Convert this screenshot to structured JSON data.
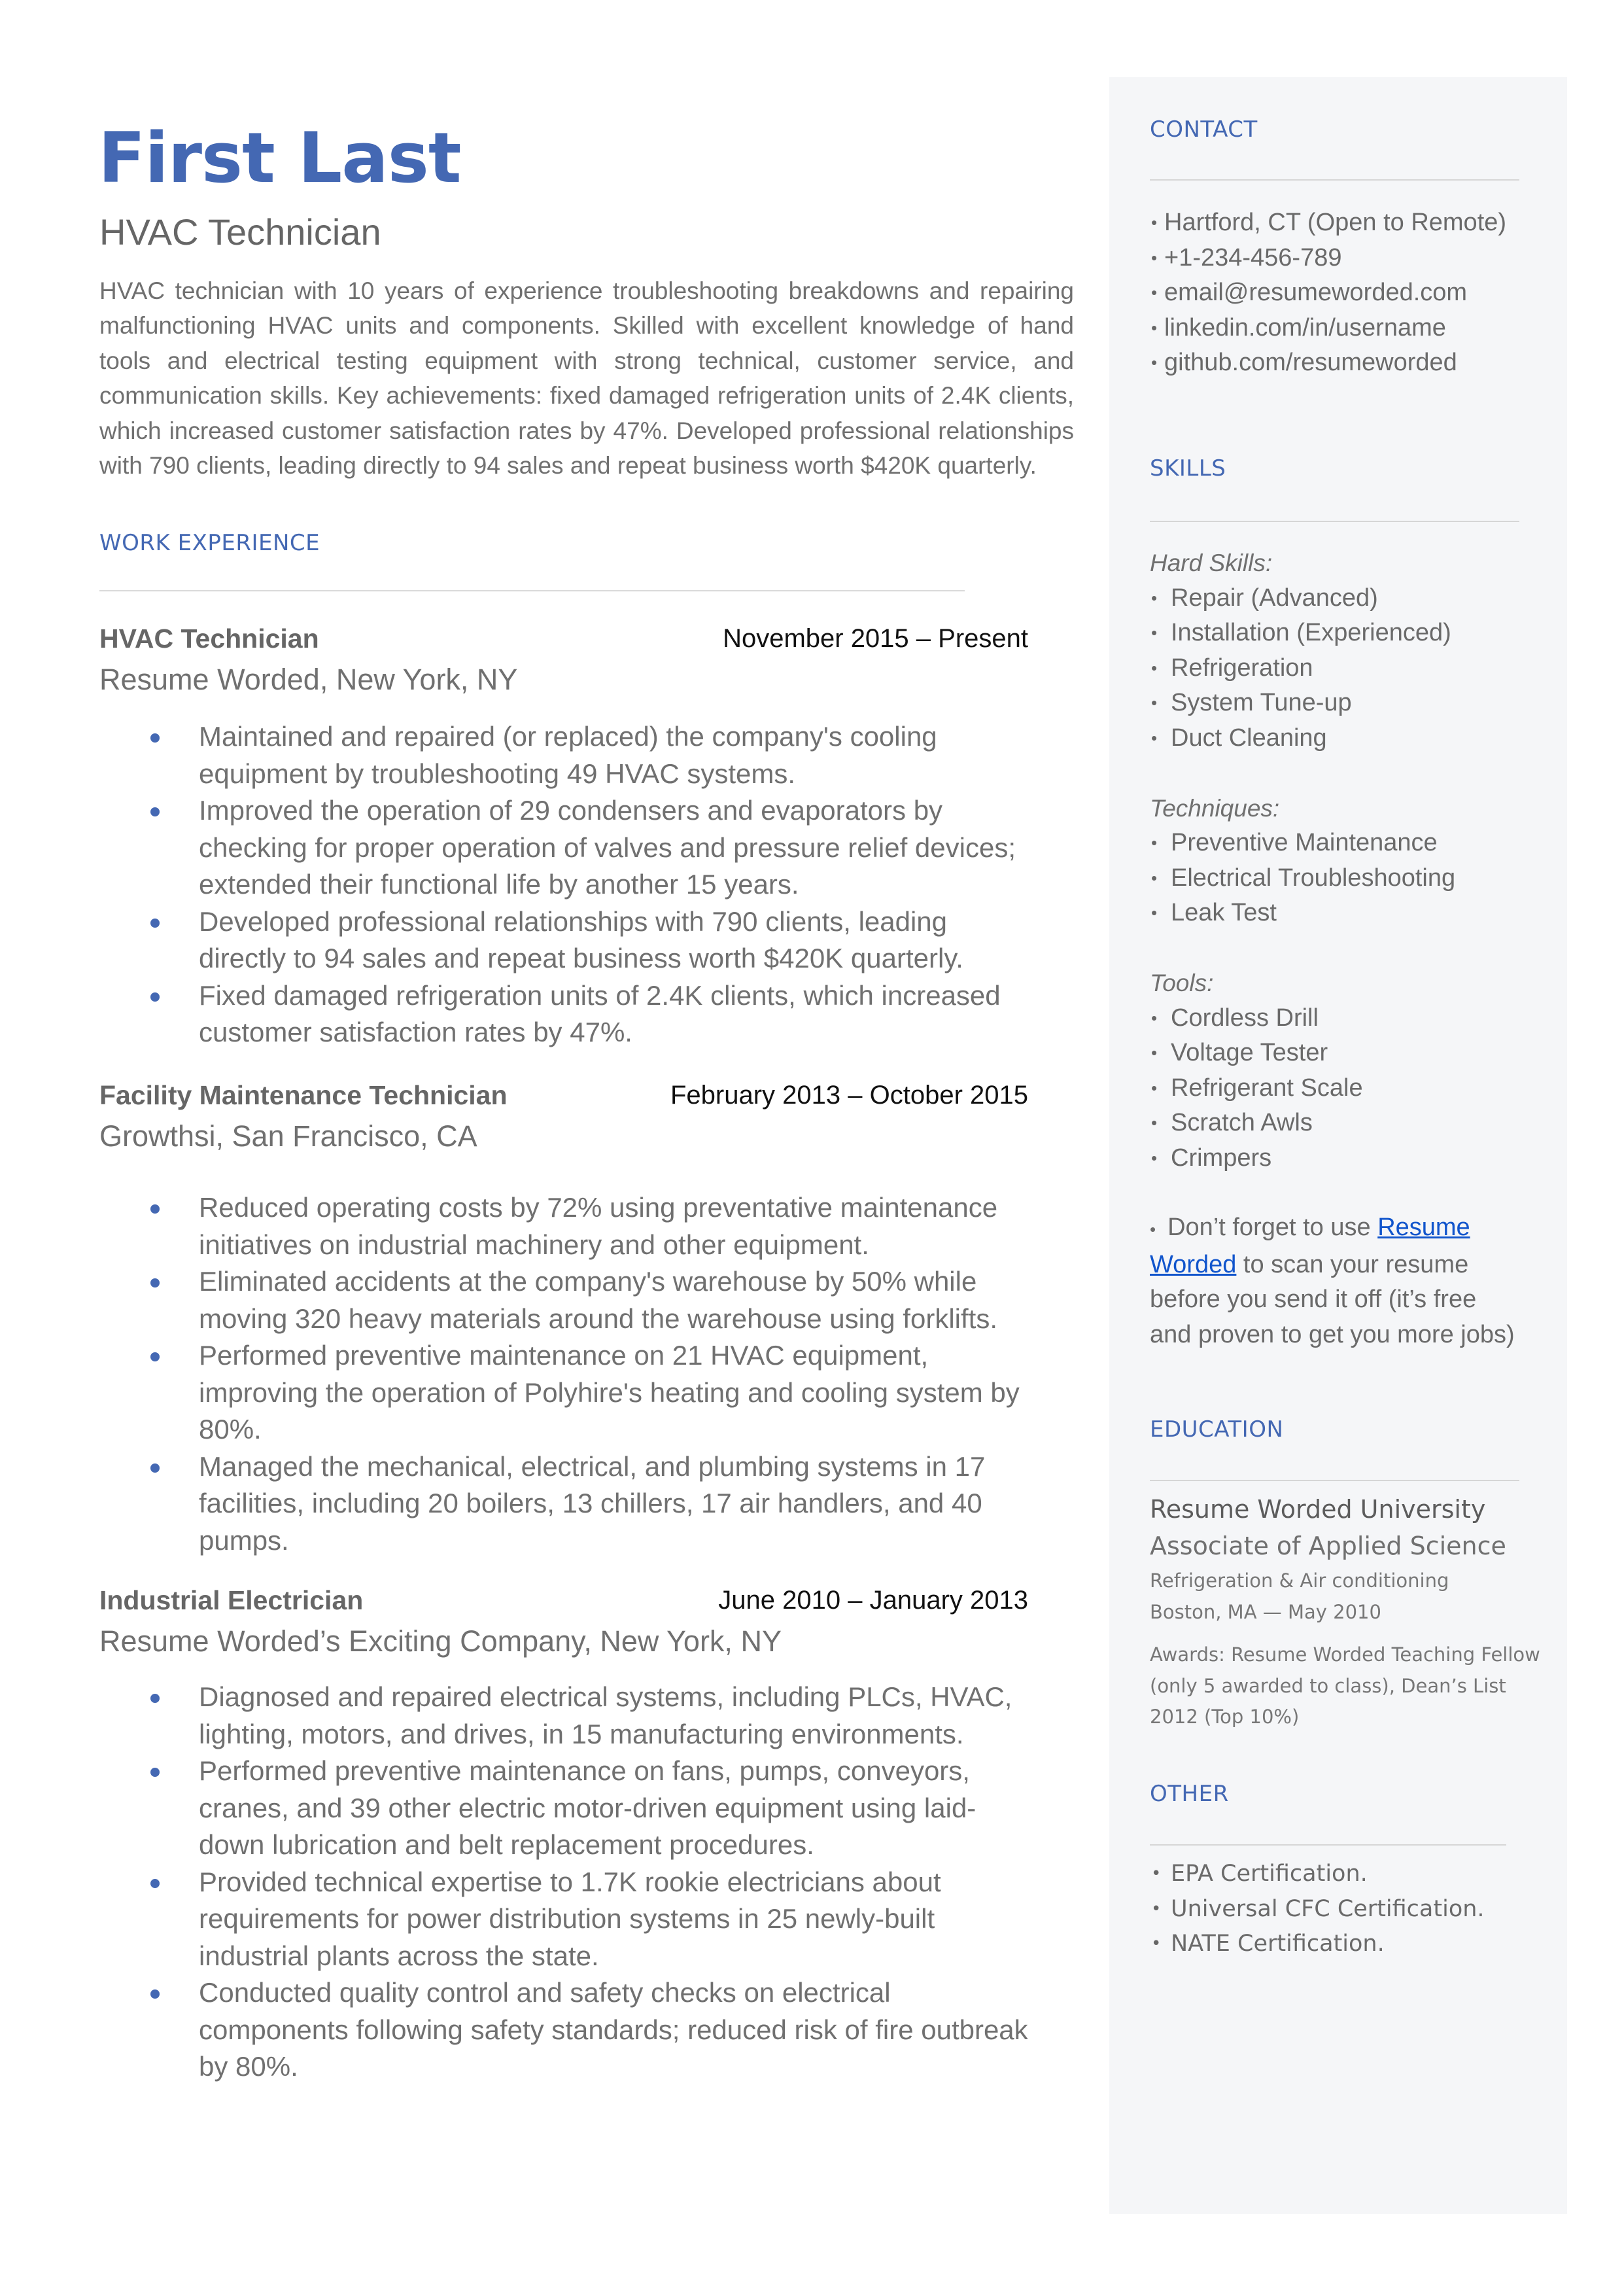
{
  "header": {
    "name": "First Last",
    "title": "HVAC Technician",
    "summary": "HVAC technician with 10 years of experience troubleshooting breakdowns and repairing malfunctioning HVAC units and components. Skilled with excellent knowledge of hand tools and electrical testing equipment with strong technical, customer service, and communication skills. Key achievements: fixed damaged refrigeration units of 2.4K clients, which increased customer satisfaction rates by 47%. Developed professional relationships with 790 clients, leading directly to 94 sales and repeat business worth $420K quarterly."
  },
  "colors": {
    "accent": "#4468B3",
    "sidebar_bg": "#F5F6F8",
    "body_text": "#666666",
    "link": "#1155CC"
  },
  "work": {
    "heading": "WORK EXPERIENCE",
    "jobs": [
      {
        "title": "HVAC Technician",
        "dates": "November 2015 – Present",
        "company": "Resume Worded, New York, NY",
        "bullets": [
          "Maintained and repaired (or replaced) the company's cooling equipment by troubleshooting 49 HVAC systems.",
          "Improved the operation of 29 condensers and evaporators by checking for proper operation of valves and pressure relief devices; extended their functional life by another 15 years.",
          "Developed professional relationships with 790 clients, leading directly to 94 sales and repeat business worth $420K quarterly.",
          "Fixed damaged refrigeration units of 2.4K clients, which increased customer satisfaction rates by 47%."
        ]
      },
      {
        "title": "Facility Maintenance Technician",
        "dates": "February 2013 – October 2015",
        "company": "Growthsi, San Francisco, CA",
        "bullets": [
          "Reduced operating costs by 72% using preventative maintenance initiatives on industrial machinery and other equipment.",
          "Eliminated accidents at the company's warehouse by 50% while moving 320 heavy materials around the warehouse using forklifts.",
          "Performed preventive maintenance on 21 HVAC equipment, improving the operation of Polyhire's heating and cooling system by 80%.",
          "Managed the mechanical, electrical, and plumbing systems in 17 facilities, including 20 boilers, 13 chillers, 17 air handlers, and 40 pumps."
        ]
      },
      {
        "title": "Industrial Electrician",
        "dates": "June 2010 – January 2013",
        "company": "Resume Worded’s Exciting Company, New York, NY",
        "bullets": [
          "Diagnosed and repaired electrical systems, including PLCs, HVAC, lighting, motors, and drives, in 15 manufacturing environments.",
          "Performed preventive maintenance on fans, pumps, conveyors, cranes, and 39 other electric motor-driven equipment using laid-down lubrication and belt replacement procedures.",
          "Provided technical expertise to 1.7K rookie electricians about requirements for power distribution systems in 25 newly-built industrial plants across the state.",
          "Conducted quality control and safety checks on electrical components following safety standards; reduced risk of fire outbreak by 80%."
        ]
      }
    ]
  },
  "contact": {
    "heading": "CONTACT",
    "items": [
      " Hartford, CT (Open to Remote)",
      "+1-234-456-789",
      "email@resumeworded.com",
      "linkedin.com/in/username",
      "github.com/resumeworded"
    ]
  },
  "skills": {
    "heading": "SKILLS",
    "groups": [
      {
        "label": "Hard Skills:",
        "items": [
          "Repair (Advanced)",
          "Installation (Experienced)",
          "Refrigeration",
          "System Tune-up",
          "Duct Cleaning"
        ]
      },
      {
        "label": "Techniques:",
        "items": [
          "Preventive Maintenance",
          "Electrical Troubleshooting",
          "Leak Test"
        ]
      },
      {
        "label": "Tools:",
        "items": [
          "Cordless Drill",
          "Voltage Tester",
          "Refrigerant Scale",
          "Scratch Awls",
          "Crimpers"
        ]
      }
    ],
    "tip": {
      "before": "Don’t forget to use ",
      "link_text": "Resume Worded",
      "after": " to scan your resume before you send it off (it’s free and proven to get you more jobs)"
    }
  },
  "education": {
    "heading": "EDUCATION",
    "school": "Resume Worded University",
    "degree": "Associate of Applied Science",
    "field": "Refrigeration & Air conditioning",
    "location_date": "Boston, MA — May 2010",
    "awards": "Awards: Resume Worded Teaching Fellow (only 5 awarded to class), Dean’s List 2012 (Top 10%)"
  },
  "other": {
    "heading": "OTHER",
    "items": [
      "EPA Certification.",
      "Universal CFC Certification.",
      "NATE Certification."
    ]
  },
  "icons": {
    "bullet_small": "•",
    "bullet_dot": "accent-dot"
  }
}
